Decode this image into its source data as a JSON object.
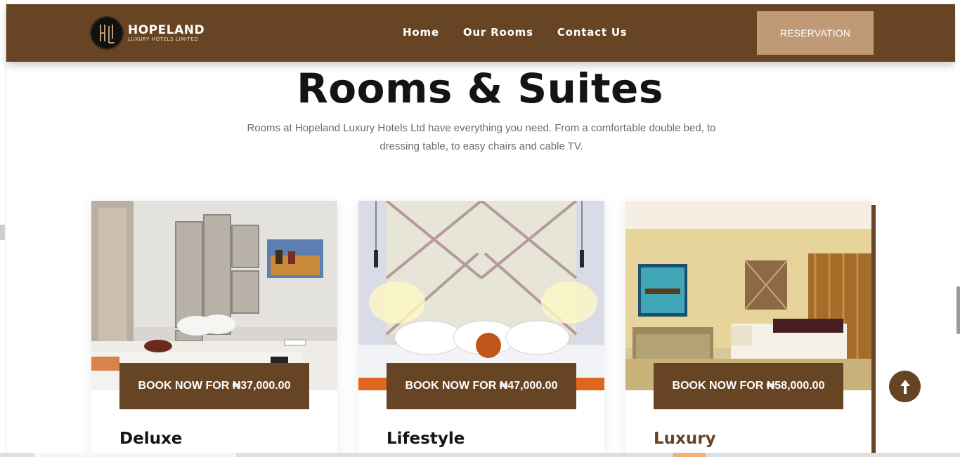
{
  "header": {
    "logo_title": "HOPELAND",
    "logo_subtitle": "LUXURY HOTELS LIMITED",
    "nav": [
      {
        "label": "Home"
      },
      {
        "label": "Our Rooms"
      },
      {
        "label": "Contact Us"
      }
    ],
    "reservation_label": "RESERVATION"
  },
  "main": {
    "title": "Rooms & Suites",
    "intro": "Rooms at Hopeland Luxury Hotels Ltd have everything you need. From a comfortable double bed, to dressing table, to easy chairs and cable TV."
  },
  "rooms": [
    {
      "name": "Deluxe",
      "book_label": "BOOK NOW FOR ₦37,000.00"
    },
    {
      "name": "Lifestyle",
      "book_label": "BOOK NOW FOR ₦47,000.00"
    },
    {
      "name": "Luxury",
      "book_label": "BOOK NOW FOR ₦58,000.00"
    }
  ],
  "colors": {
    "brand_brown": "#674423",
    "reservation_tan": "#c09a77",
    "text_dark": "#141414",
    "text_muted": "#6b6b6b"
  },
  "icons": {
    "scroll_top": "arrow-up-icon",
    "logo": "hopeland-monogram-icon"
  }
}
